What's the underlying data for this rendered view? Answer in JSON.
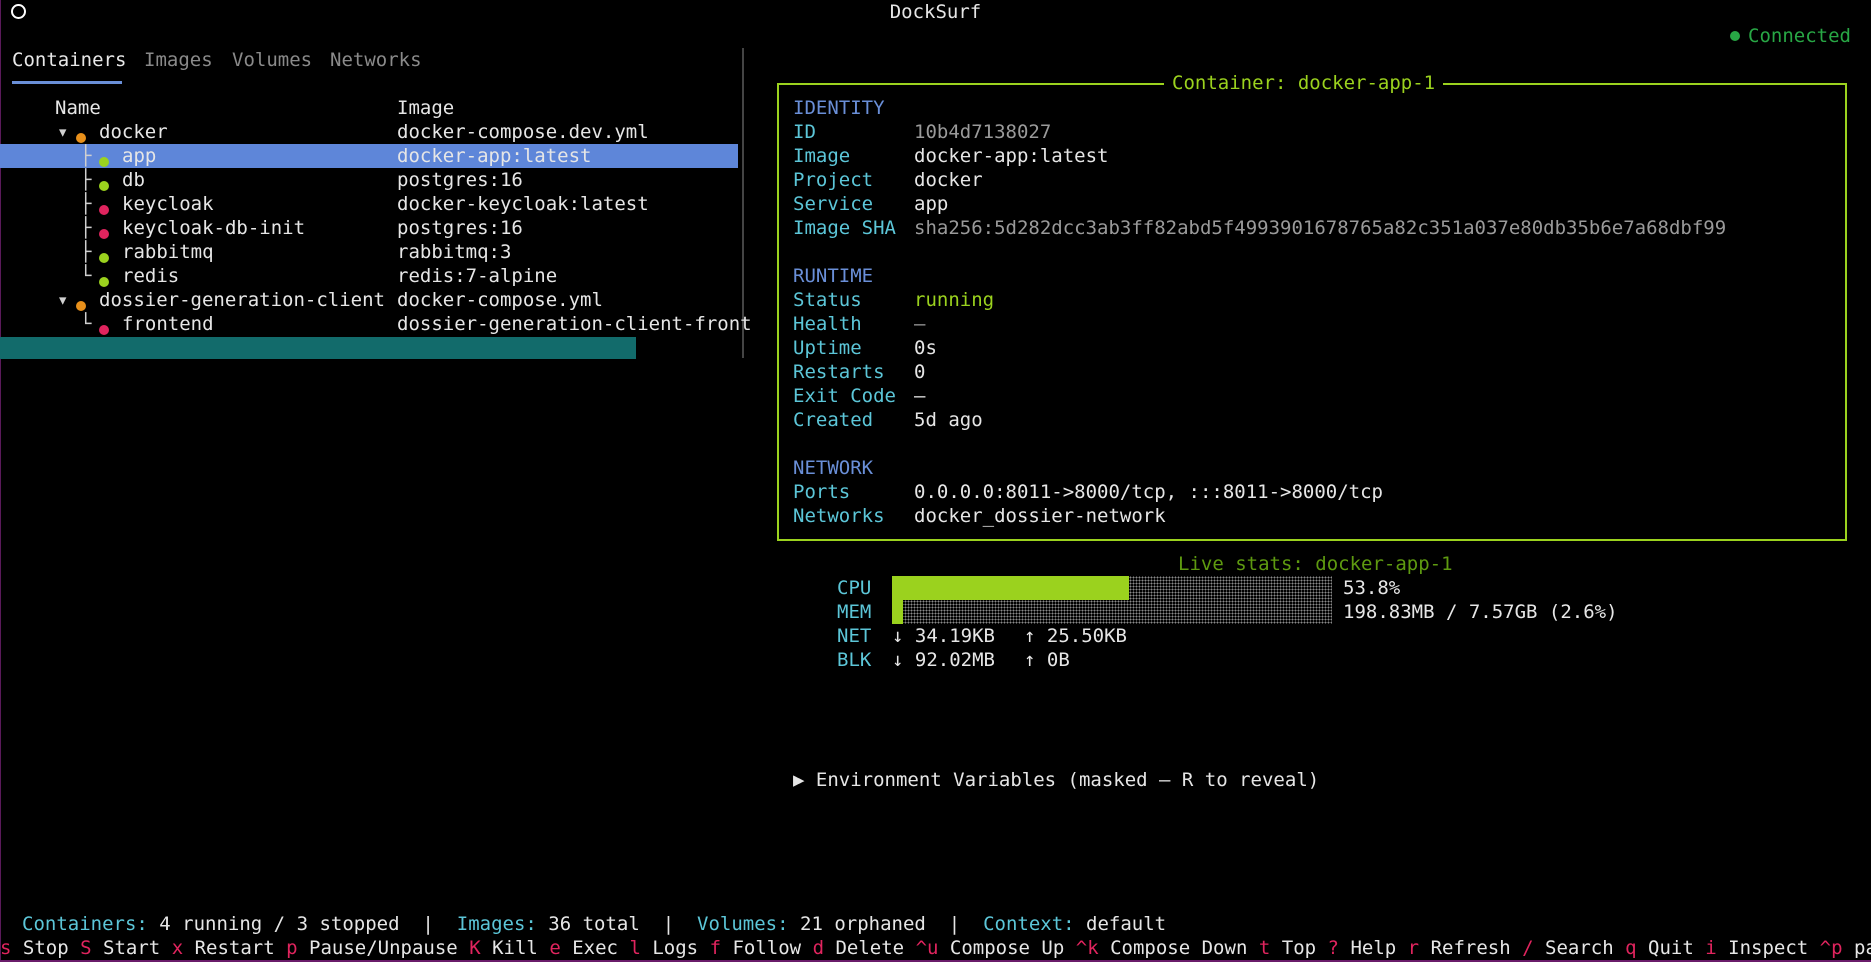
{
  "window": {
    "title": "DockSurf"
  },
  "connection": {
    "status": "Connected"
  },
  "tabs": [
    {
      "label": "Containers"
    },
    {
      "label": "Images"
    },
    {
      "label": "Volumes"
    },
    {
      "label": "Networks"
    }
  ],
  "table": {
    "headers": {
      "name": "Name",
      "image": "Image"
    },
    "rows": [
      {
        "tree": "▾",
        "status": "orange",
        "name": "docker",
        "image": "docker-compose.dev.yml"
      },
      {
        "tree": "├",
        "status": "green",
        "name": "app",
        "image": "docker-app:latest"
      },
      {
        "tree": "├",
        "status": "green",
        "name": "db",
        "image": "postgres:16"
      },
      {
        "tree": "├",
        "status": "red",
        "name": "keycloak",
        "image": "docker-keycloak:latest"
      },
      {
        "tree": "├",
        "status": "red",
        "name": "keycloak-db-init",
        "image": "postgres:16"
      },
      {
        "tree": "├",
        "status": "green",
        "name": "rabbitmq",
        "image": "rabbitmq:3"
      },
      {
        "tree": "└",
        "status": "green",
        "name": "redis",
        "image": "redis:7-alpine"
      },
      {
        "tree": "▾",
        "status": "orange",
        "name": "dossier-generation-client",
        "image": "docker-compose.yml"
      },
      {
        "tree": "└",
        "status": "red",
        "name": "frontend",
        "image": "dossier-generation-client-front"
      }
    ]
  },
  "detail": {
    "title": "Container: docker-app-1",
    "identity": {
      "heading": "IDENTITY",
      "id_label": "ID",
      "id": "10b4d7138027",
      "image_label": "Image",
      "image": "docker-app:latest",
      "project_label": "Project",
      "project": "docker",
      "service_label": "Service",
      "service": "app",
      "sha_label": "Image SHA",
      "sha": "sha256:5d282dcc3ab3ff82abd5f4993901678765a82c351a037e80db35b6e7a68dbf99"
    },
    "runtime": {
      "heading": "RUNTIME",
      "status_label": "Status",
      "status": "running",
      "health_label": "Health",
      "health": "—",
      "uptime_label": "Uptime",
      "uptime": "0s",
      "restarts_label": "Restarts",
      "restarts": "0",
      "exit_label": "Exit Code",
      "exit": "—",
      "created_label": "Created",
      "created": "5d ago"
    },
    "network": {
      "heading": "NETWORK",
      "ports_label": "Ports",
      "ports": "0.0.0.0:8011->8000/tcp, :::8011->8000/tcp",
      "networks_label": "Networks",
      "networks": "docker_dossier-network"
    }
  },
  "live_stats": {
    "title": "Live stats: docker-app-1",
    "cpu_label": "CPU",
    "cpu_text": "53.8%",
    "cpu_fraction": 0.538,
    "mem_label": "MEM",
    "mem_text": "198.83MB / 7.57GB (2.6%)",
    "mem_fraction": 0.026,
    "net_label": "NET",
    "net_down": "↓ 34.19KB",
    "net_up": "↑ 25.50KB",
    "blk_label": "BLK",
    "blk_down": "↓ 92.02MB",
    "blk_up": "↑ 0B"
  },
  "env": {
    "label": "▶ Environment Variables (masked — R to reveal)"
  },
  "status_bar": {
    "containers_label": "Containers:",
    "containers": "4 running / 3 stopped",
    "images_label": "Images:",
    "images": "36 total",
    "volumes_label": "Volumes:",
    "volumes": "21 orphaned",
    "context_label": "Context:",
    "context": "default",
    "sep": "|"
  },
  "keybar": [
    {
      "key": "s",
      "label": "Stop"
    },
    {
      "key": "S",
      "label": "Start"
    },
    {
      "key": "x",
      "label": "Restart"
    },
    {
      "key": "p",
      "label": "Pause/Unpause"
    },
    {
      "key": "K",
      "label": "Kill"
    },
    {
      "key": "e",
      "label": "Exec"
    },
    {
      "key": "l",
      "label": "Logs"
    },
    {
      "key": "f",
      "label": "Follow"
    },
    {
      "key": "d",
      "label": "Delete"
    },
    {
      "key": "^u",
      "label": "Compose Up"
    },
    {
      "key": "^k",
      "label": "Compose Down"
    },
    {
      "key": "t",
      "label": "Top"
    },
    {
      "key": "?",
      "label": "Help"
    },
    {
      "key": "r",
      "label": "Refresh"
    },
    {
      "key": "/",
      "label": "Search"
    },
    {
      "key": "q",
      "label": "Quit"
    },
    {
      "key": "i",
      "label": "Inspect"
    },
    {
      "key": "^p",
      "label": "paletteg"
    }
  ]
}
